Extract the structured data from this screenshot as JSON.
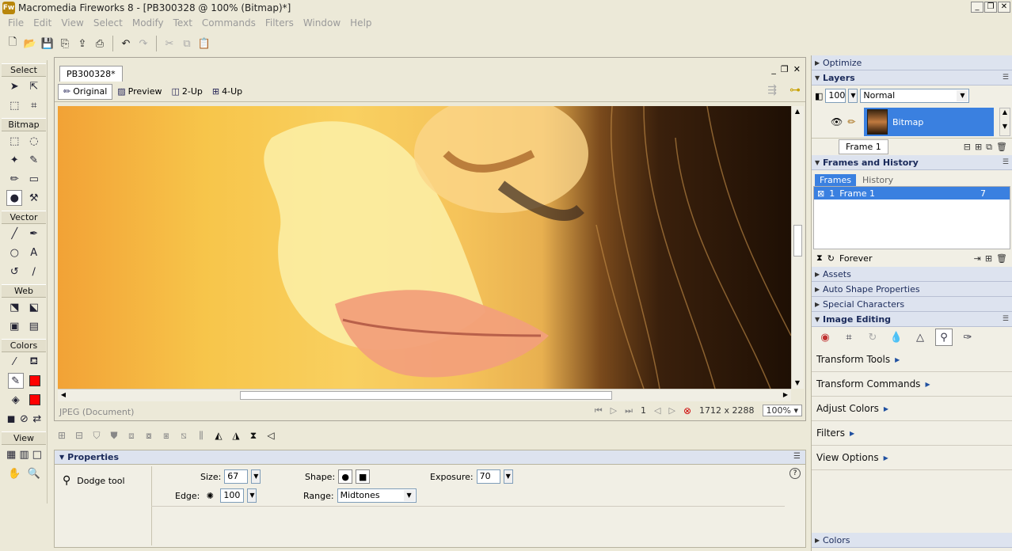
{
  "window": {
    "title": "Macromedia Fireworks 8 - [PB300328 @ 100% (Bitmap)*]",
    "app_icon": "Fw"
  },
  "menu": [
    "File",
    "Edit",
    "View",
    "Select",
    "Modify",
    "Text",
    "Commands",
    "Filters",
    "Window",
    "Help"
  ],
  "tools": {
    "select": "Select",
    "bitmap": "Bitmap",
    "vector": "Vector",
    "web": "Web",
    "colors": "Colors",
    "view": "View",
    "stroke_color": "#ff0000",
    "fill_color": "#ff0000"
  },
  "document": {
    "tab": "PB300328*",
    "views": [
      "Original",
      "Preview",
      "2-Up",
      "4-Up"
    ],
    "doc_type": "JPEG (Document)",
    "frame_number": "1",
    "dimensions": "1712 x 2288",
    "zoom": "100%"
  },
  "properties": {
    "title": "Properties",
    "tool_name": "Dodge tool",
    "size_label": "Size:",
    "size_value": "67",
    "edge_label": "Edge:",
    "edge_value": "100",
    "shape_label": "Shape:",
    "range_label": "Range:",
    "range_value": "Midtones",
    "exposure_label": "Exposure:",
    "exposure_value": "70"
  },
  "panels": {
    "optimize": "Optimize",
    "layers": "Layers",
    "layer_opacity": "100",
    "blend_mode": "Normal",
    "layer_name": "Bitmap",
    "frame_tab": "Frame 1",
    "frames_history": "Frames and History",
    "frames_tab": "Frames",
    "history_tab": "History",
    "frame_row_num": "1",
    "frame_row_name": "Frame 1",
    "frame_row_delay": "7",
    "loop": "Forever",
    "assets": "Assets",
    "auto_shape": "Auto Shape Properties",
    "special_chars": "Special Characters",
    "image_editing": "Image Editing",
    "ie_sections": [
      "Transform Tools",
      "Transform Commands",
      "Adjust Colors",
      "Filters",
      "View Options"
    ],
    "colors": "Colors"
  }
}
